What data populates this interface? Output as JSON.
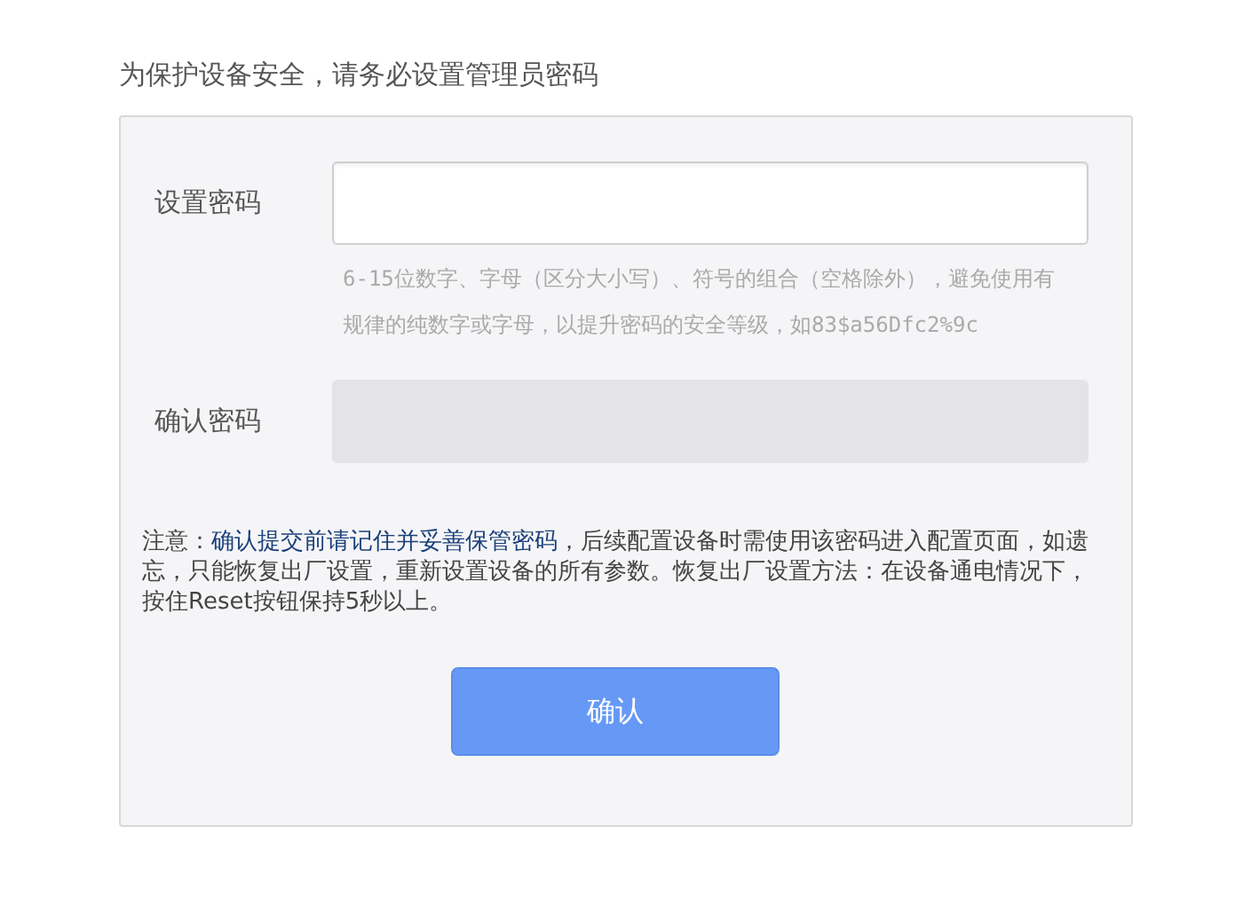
{
  "heading": "为保护设备安全，请务必设置管理员密码",
  "fields": [
    {
      "label": "设置密码",
      "disabled": false,
      "hint": "6-15位数字、字母（区分大小写）、符号的组合（空格除外），避免使用有规律的纯数字或字母，以提升密码的安全等级，如83$a56Dfc2%9c"
    },
    {
      "label": "确认密码",
      "disabled": true
    }
  ],
  "note": "注意：**确认提交前请记住并妥善保管密码**，后续配置设备时需使用该密码进入配置页面，如遗忘，只能恢复出厂设置，重新设置设备的所有参数。恢复出厂设置方法：在设备通电情况下，按住Reset按钮保持5秒以上。",
  "button": "确认"
}
